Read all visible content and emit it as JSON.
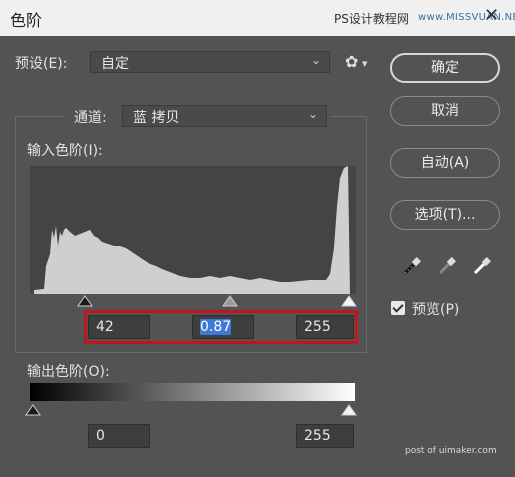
{
  "window": {
    "title": "色阶",
    "watermark_cn": "PS设计教程网",
    "watermark_url": "www.MISSVUAN.NET",
    "close_glyph": "✕"
  },
  "preset": {
    "label": "预设(E):",
    "value": "自定",
    "gear_icon": "gear-icon"
  },
  "channel": {
    "label": "通道:",
    "value": "蓝 拷贝"
  },
  "input_levels": {
    "label": "输入色阶(I):",
    "black": "42",
    "gamma": "0.87",
    "white": "255"
  },
  "output_levels": {
    "label": "输出色阶(O):",
    "black": "0",
    "white": "255"
  },
  "buttons": {
    "ok": "确定",
    "cancel": "取消",
    "auto": "自动(A)",
    "options": "选项(T)..."
  },
  "preview": {
    "label": "预览(P)",
    "checked": true
  },
  "eyedroppers": [
    "eyedropper-black-icon",
    "eyedropper-gray-icon",
    "eyedropper-white-icon"
  ],
  "footer": {
    "text": "post of uimaker.com"
  },
  "colors": {
    "panel": "#535353",
    "highlight": "#c0161d",
    "histogram": "#cfcfcf",
    "selection": "#3d7ad6"
  }
}
